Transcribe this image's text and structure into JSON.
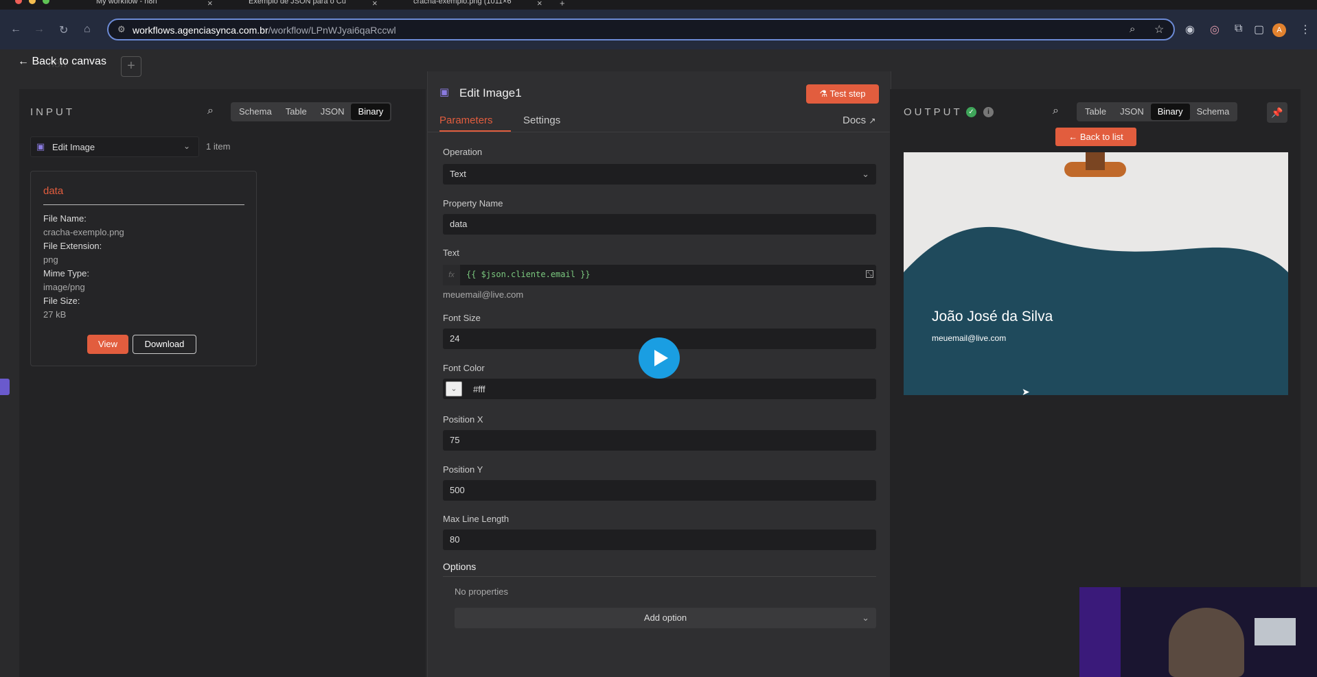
{
  "browser": {
    "tabs": [
      {
        "title": "My workflow - n8n"
      },
      {
        "title": "Exemplo de JSON para o Cu"
      },
      {
        "title": "cracha-exemplo.png (1011×6"
      }
    ],
    "url_host": "workflows.agenciasynca.com.br",
    "url_path": "/workflow/LPnWJyai6qaRccwl",
    "avatar_letter": "A"
  },
  "app": {
    "back_to_canvas": "Back to canvas",
    "bg_label": "n8n"
  },
  "input_panel": {
    "title": "INPUT",
    "tabs": [
      {
        "label": "Schema"
      },
      {
        "label": "Table"
      },
      {
        "label": "JSON"
      },
      {
        "label": "Binary"
      }
    ],
    "active_tab": "Binary",
    "node_select": "Edit Image",
    "item_count": "1 item",
    "card": {
      "title": "data",
      "file_name_label": "File Name:",
      "file_name": "cracha-exemplo.png",
      "file_ext_label": "File Extension:",
      "file_ext": "png",
      "mime_label": "Mime Type:",
      "mime": "image/png",
      "size_label": "File Size:",
      "size": "27 kB",
      "view_label": "View",
      "download_label": "Download"
    }
  },
  "modal": {
    "title": "Edit Image1",
    "test_step": "Test step",
    "tabs": {
      "parameters": "Parameters",
      "settings": "Settings",
      "docs": "Docs"
    },
    "fields": {
      "operation_label": "Operation",
      "operation_value": "Text",
      "property_label": "Property Name",
      "property_value": "data",
      "text_label": "Text",
      "fx": "fx",
      "text_expression": "{{ $json.cliente.email }}",
      "text_preview": "meuemail@live.com",
      "fontsize_label": "Font Size",
      "fontsize_value": "24",
      "fontcolor_label": "Font Color",
      "fontcolor_value": "#fff",
      "posx_label": "Position X",
      "posx_value": "75",
      "posy_label": "Position Y",
      "posy_value": "500",
      "maxline_label": "Max Line Length",
      "maxline_value": "80",
      "options_label": "Options",
      "no_properties": "No properties",
      "add_option": "Add option"
    }
  },
  "output_panel": {
    "title": "OUTPUT",
    "tabs": [
      {
        "label": "Table"
      },
      {
        "label": "JSON"
      },
      {
        "label": "Binary"
      },
      {
        "label": "Schema"
      }
    ],
    "active_tab": "Binary",
    "back_to_list": "Back to list",
    "badge": {
      "name": "João José da Silva",
      "email": "meuemail@live.com"
    }
  },
  "colors": {
    "accent": "#e25d3e",
    "badge_wave": "#1f4a5c",
    "badge_bg": "#e9e8e7",
    "play": "#1a9ee2"
  }
}
